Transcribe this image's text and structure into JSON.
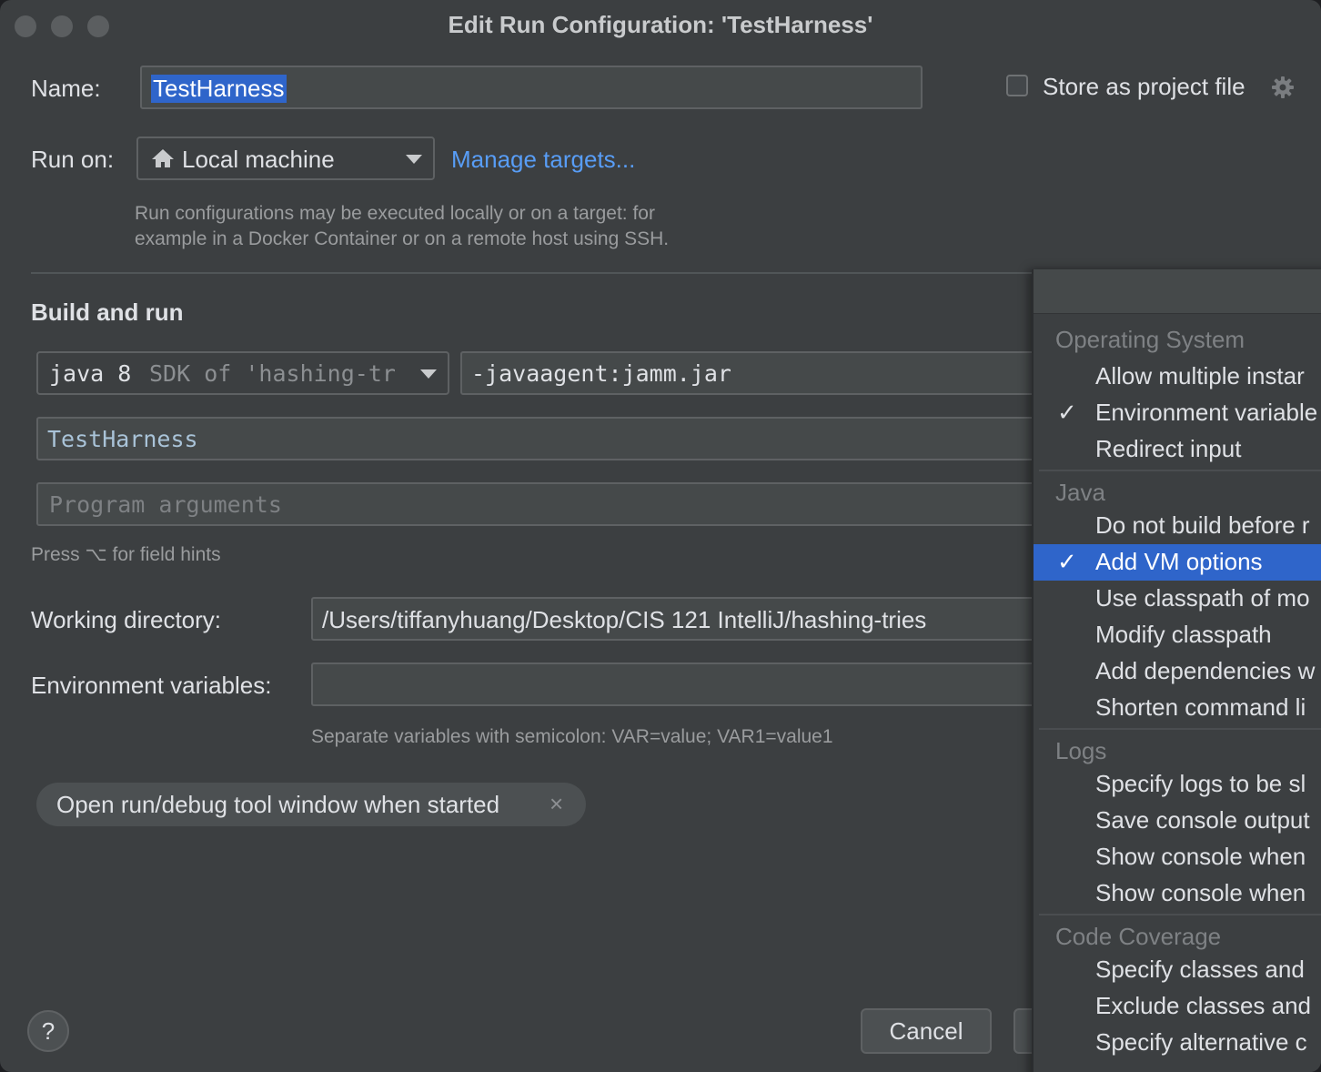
{
  "window": {
    "title": "Edit Run Configuration: 'TestHarness'"
  },
  "name": {
    "label": "Name:",
    "value": "TestHarness"
  },
  "store": {
    "label": "Store as project file"
  },
  "run_on": {
    "label": "Run on:",
    "value": "Local machine",
    "manage_link": "Manage targets...",
    "hint_line1": "Run configurations may be executed locally or on a target: for",
    "hint_line2": "example in a Docker Container or on a remote host using SSH."
  },
  "build": {
    "title": "Build and run",
    "sdk_main": "java 8",
    "sdk_detail": "SDK of 'hashing-tr",
    "vm_options": "-javaagent:jamm.jar",
    "main_class": "TestHarness",
    "program_args_placeholder": "Program arguments",
    "field_hint": "Press ⌥ for field hints"
  },
  "working_dir": {
    "label": "Working directory:",
    "value": "/Users/tiffanyhuang/Desktop/CIS 121 IntelliJ/hashing-tries"
  },
  "env": {
    "label": "Environment variables:",
    "value": "",
    "hint": "Separate variables with semicolon: VAR=value; VAR1=value1"
  },
  "chip": {
    "label": "Open run/debug tool window when started",
    "close": "×"
  },
  "buttons": {
    "cancel": "Cancel",
    "help": "?"
  },
  "popup": {
    "groups": [
      {
        "title": "Operating System",
        "items": [
          {
            "label": "Allow multiple instar",
            "checked": false
          },
          {
            "label": "Environment variable",
            "checked": true
          },
          {
            "label": "Redirect input",
            "checked": false
          }
        ]
      },
      {
        "title": "Java",
        "items": [
          {
            "label": "Do not build before r",
            "checked": false
          },
          {
            "label": "Add VM options",
            "checked": true,
            "selected": true
          },
          {
            "label": "Use classpath of mo",
            "checked": false
          },
          {
            "label": "Modify classpath",
            "checked": false
          },
          {
            "label": "Add dependencies w",
            "checked": false
          },
          {
            "label": "Shorten command li",
            "checked": false
          }
        ]
      },
      {
        "title": "Logs",
        "items": [
          {
            "label": "Specify logs to be sl",
            "checked": false
          },
          {
            "label": "Save console output",
            "checked": false
          },
          {
            "label": "Show console when",
            "checked": false
          },
          {
            "label": "Show console when",
            "checked": false
          }
        ]
      },
      {
        "title": "Code Coverage",
        "items": [
          {
            "label": "Specify classes and",
            "checked": false
          },
          {
            "label": "Exclude classes and",
            "checked": false
          },
          {
            "label": "Specify alternative c",
            "checked": false
          }
        ]
      }
    ],
    "check_glyph": "✓"
  },
  "colors": {
    "background": "#3c3f41",
    "field": "#45494a",
    "accent": "#2f65ca",
    "link": "#589df6"
  }
}
